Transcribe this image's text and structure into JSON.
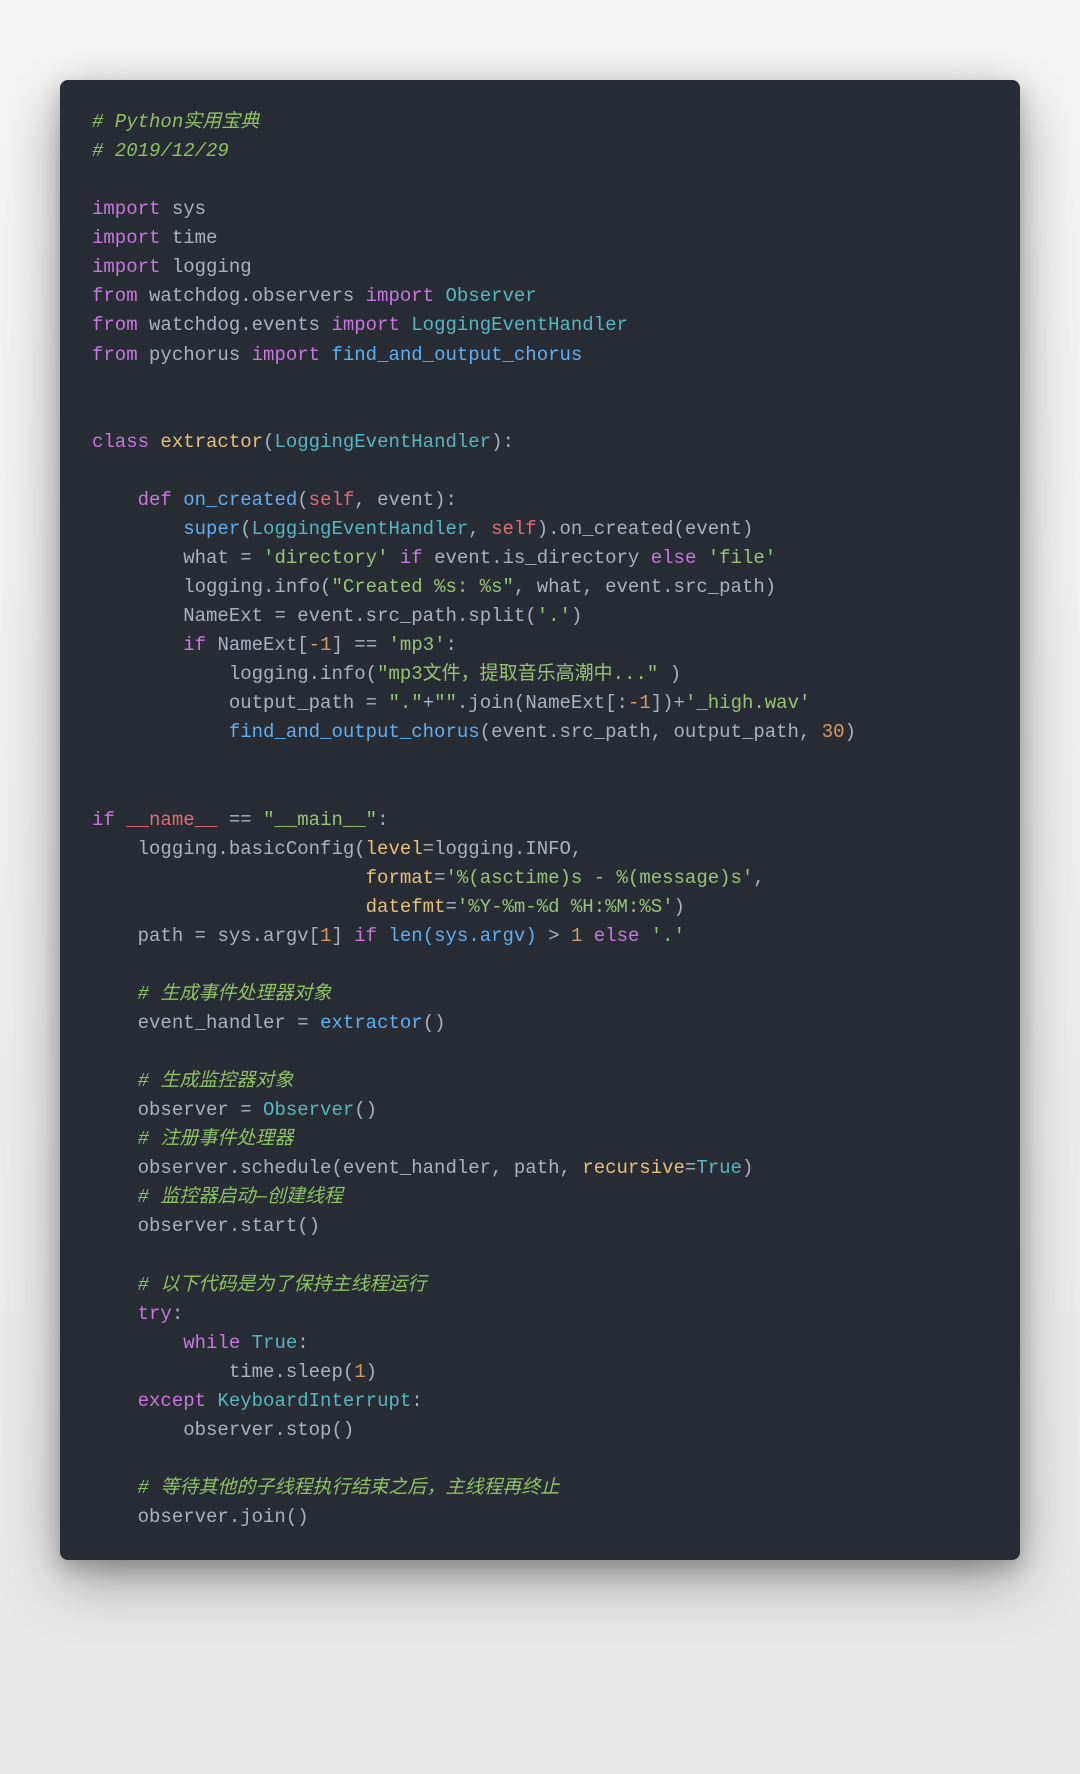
{
  "code": {
    "c1": "# Python实用宝典",
    "c2": "# 2019/12/29",
    "kw_import": "import",
    "kw_from": "from",
    "kw_class": "class",
    "kw_def": "def",
    "kw_if": "if",
    "kw_else": "else",
    "kw_while": "while",
    "kw_try": "try",
    "kw_except": "except",
    "mod_sys": "sys",
    "mod_time": "time",
    "mod_logging": "logging",
    "mod_wd_obs": "watchdog.observers",
    "cls_observer": "Observer",
    "mod_wd_ev": "watchdog.events",
    "cls_leh": "LoggingEventHandler",
    "mod_pychorus": "pychorus",
    "fn_facoc": "find_and_output_chorus",
    "cls_extractor": "extractor",
    "lp": "(",
    "rp": ")",
    "colon": ":",
    "comma": ",",
    "eq": "=",
    "eqeq": "==",
    "gt": ">",
    "plus": "+",
    "dot": ".",
    "lb": "[",
    "rb": "]",
    "fn_on_created": "on_created",
    "self": "self",
    "event": "event",
    "fn_super": "super",
    "meth_on_created": ".on_created(event)",
    "what_id": "what",
    "str_directory": "'directory'",
    "attr_isdir": "event.is_directory",
    "str_file": "'file'",
    "meth_info": "logging.info(",
    "str_created": "\"Created %s: %s\"",
    "src_path": "event.src_path",
    "nameext": "NameExt",
    "meth_split": "event.src_path.split(",
    "str_dot": "'.'",
    "idx_m1": "-1",
    "str_mp3": "'mp3'",
    "str_mp3msg": "\"mp3文件，提取音乐高潮中...\"",
    "out_path": "output_path",
    "str_dotq": "\".\"",
    "str_empty": "\"\"",
    "meth_join": ".join(NameExt[:",
    "str_highwav": "'_high.wav'",
    "num_30": "30",
    "name_dunder": "__name__",
    "main_str": "\"__main__\"",
    "basic_cfg": "logging.basicConfig(",
    "kw_level": "level",
    "log_info": "logging.INFO",
    "kw_format": "format",
    "str_fmt": "'%(asctime)s - %(message)s'",
    "kw_datefmt": "datefmt",
    "str_datefmt": "'%Y-%m-%d %H:%M:%S'",
    "path_id": "path",
    "sys_argv1": "sys.argv[",
    "num_1": "1",
    "len_argv": "len(sys.argv)",
    "c3": "# 生成事件处理器对象",
    "ev_handler": "event_handler",
    "c4": "# 生成监控器对象",
    "observer_id": "observer",
    "c5": "# 注册事件处理器",
    "meth_schedule": "observer.schedule(event_handler, path, ",
    "kw_recursive": "recursive",
    "true": "True",
    "c6": "# 监控器启动—创建线程",
    "obs_start": "observer.start()",
    "c7": "# 以下代码是为了保持主线程运行",
    "time_sleep": "time.sleep(",
    "cls_kbi": "KeyboardInterrupt",
    "obs_stop": "observer.stop()",
    "c8": "# 等待其他的子线程执行结束之后，主线程再终止",
    "obs_join": "observer.join()",
    "sp1": " ",
    "sp4": "    ",
    "sp8": "        ",
    "sp12": "            ",
    "sp16": "                ",
    "sp_align_fmt": "                        ",
    "rparen_close": "])+"
  }
}
